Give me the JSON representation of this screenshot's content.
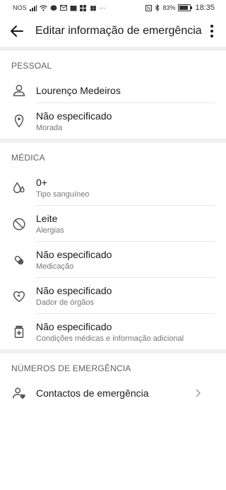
{
  "status": {
    "left_text": "NOS",
    "battery_percent": "83%",
    "battery_level": 0.83,
    "time": "18:35"
  },
  "appbar": {
    "title": "Editar informação de emergência"
  },
  "sections": {
    "personal": {
      "header": "PESSOAL",
      "name": "Lourenço Medeiros",
      "address_value": "Não especificado",
      "address_label": "Morada"
    },
    "medical": {
      "header": "MÉDICA",
      "blood_value": "0+",
      "blood_label": "Tipo sanguíneo",
      "allergies_value": "Leite",
      "allergies_label": "Alergias",
      "medication_value": "Não especificado",
      "medication_label": "Medicação",
      "donor_value": "Não especificado",
      "donor_label": "Dador de órgãos",
      "conditions_value": "Não especificado",
      "conditions_label": "Condições médicas e informação adicional"
    },
    "emergency": {
      "header": "NÚMEROS DE EMERGÊNCIA",
      "contacts_label": "Contactos de emergência"
    }
  },
  "icons": {
    "back": "arrow-left",
    "more": "more-vertical",
    "person": "person-outline",
    "location": "location-pin",
    "blood": "drops",
    "allergy": "block",
    "medication": "pill",
    "donor": "heart-outline",
    "conditions": "medical-bottle",
    "contacts": "person-heart",
    "chevron": "chevron-right"
  }
}
